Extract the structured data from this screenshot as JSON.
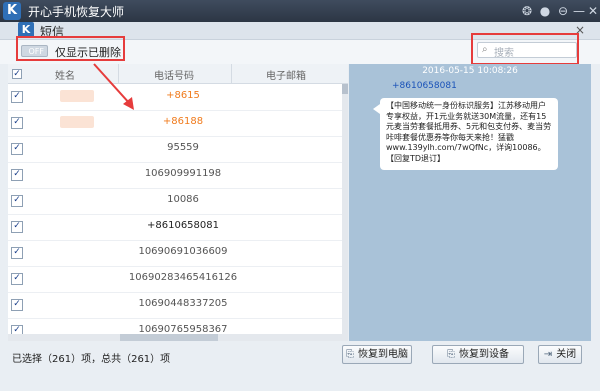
{
  "app": {
    "logo": "K",
    "title": "开心手机恢复大师"
  },
  "window_icons": [
    "wechat-icon",
    "chat-icon",
    "menu-icon",
    "minimize-icon",
    "close-icon"
  ],
  "window_glyphs": [
    "❂",
    "●",
    "⊖",
    "—",
    "✕"
  ],
  "sub_window": {
    "logo": "K",
    "title": "短信",
    "close": "×"
  },
  "toolbar": {
    "toggle_text": "OFF",
    "toggle_label": "仅显示已删除",
    "search_placeholder": "搜索",
    "search_glyph": "⌕"
  },
  "table": {
    "headers": [
      "姓名",
      "电话号码",
      "电子邮箱"
    ],
    "check_mark": "✓",
    "rows": [
      {
        "phone": "+8615",
        "style": "orange",
        "name_blurred": true
      },
      {
        "phone": "+86188",
        "style": "orange",
        "name_blurred": true
      },
      {
        "phone": "95559",
        "style": "normal"
      },
      {
        "phone": "106909991198",
        "style": "normal"
      },
      {
        "phone": "10086",
        "style": "normal"
      },
      {
        "phone": "+8610658081",
        "style": "dark"
      },
      {
        "phone": "10690691036609",
        "style": "normal"
      },
      {
        "phone": "10690283465416126",
        "style": "normal"
      },
      {
        "phone": "10690448337205",
        "style": "normal"
      },
      {
        "phone": "10690765958367",
        "style": "normal"
      }
    ]
  },
  "message": {
    "date": "2016-05-15 10:08:26",
    "sender": "+8610658081",
    "body": "【中国移动统一身份标识服务】江苏移动用户专享权益，开1元业务就送30M流量，还有15元麦当劳套餐抵用券、5元和包支付券、麦当劳咔啡套餐优惠券等你每天来抢！猛戳 www.139ylh.com/7wQfNc，详询10086。【回复TD退订】"
  },
  "footer": {
    "status": "已选择（261）项，总共（261）项",
    "buttons": [
      {
        "label": "恢复到电脑",
        "icon": "computer-restore-icon",
        "glyph": "⎘"
      },
      {
        "label": "恢复到设备",
        "icon": "device-restore-icon",
        "glyph": "⎘"
      },
      {
        "label": "关闭",
        "icon": "exit-icon",
        "glyph": "⇥"
      }
    ]
  },
  "colors": {
    "highlight": "#e63c3c",
    "accent": "#2f6fb6",
    "orange": "#f07b1d"
  }
}
